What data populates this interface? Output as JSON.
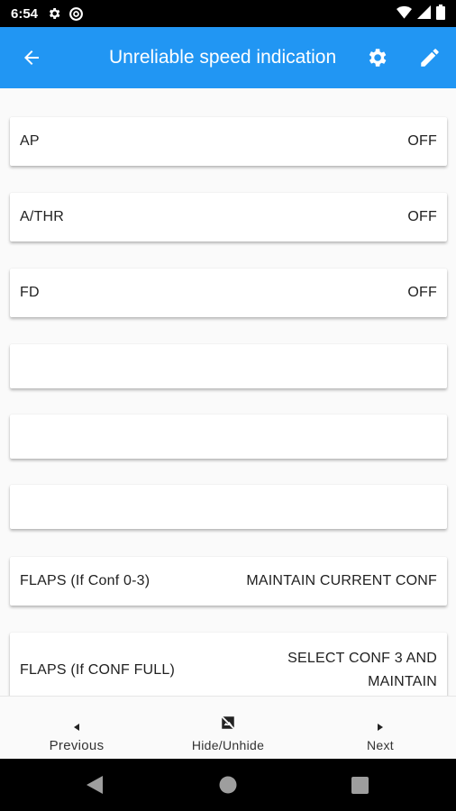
{
  "status_bar": {
    "time": "6:54",
    "icons": [
      "gear-icon",
      "at-sync-icon",
      "wifi-icon",
      "signal-icon",
      "battery-icon"
    ]
  },
  "app_bar": {
    "title": "Unreliable speed indication",
    "color": "#2196f3",
    "icons": [
      "back-arrow-icon",
      "gear-icon",
      "pencil-icon"
    ]
  },
  "checklist": {
    "items": [
      {
        "label": "AP",
        "value": "OFF"
      },
      {
        "label": "A/THR",
        "value": "OFF"
      },
      {
        "label": "FD",
        "value": "OFF"
      },
      {
        "label": "",
        "value": ""
      },
      {
        "label": "",
        "value": ""
      },
      {
        "label": "",
        "value": ""
      },
      {
        "label": "FLAPS (If Conf 0-3)",
        "value": "MAINTAIN CURRENT CONF"
      },
      {
        "label": "FLAPS (If CONF FULL)",
        "value": "SELECT CONF 3 AND MAINTAIN"
      }
    ]
  },
  "bottom_nav": {
    "previous_label": "Previous",
    "hide_label": "Hide/Unhide",
    "next_label": "Next"
  },
  "system_nav": {
    "icons": [
      "back-triangle-icon",
      "home-circle-icon",
      "recents-square-icon"
    ]
  }
}
